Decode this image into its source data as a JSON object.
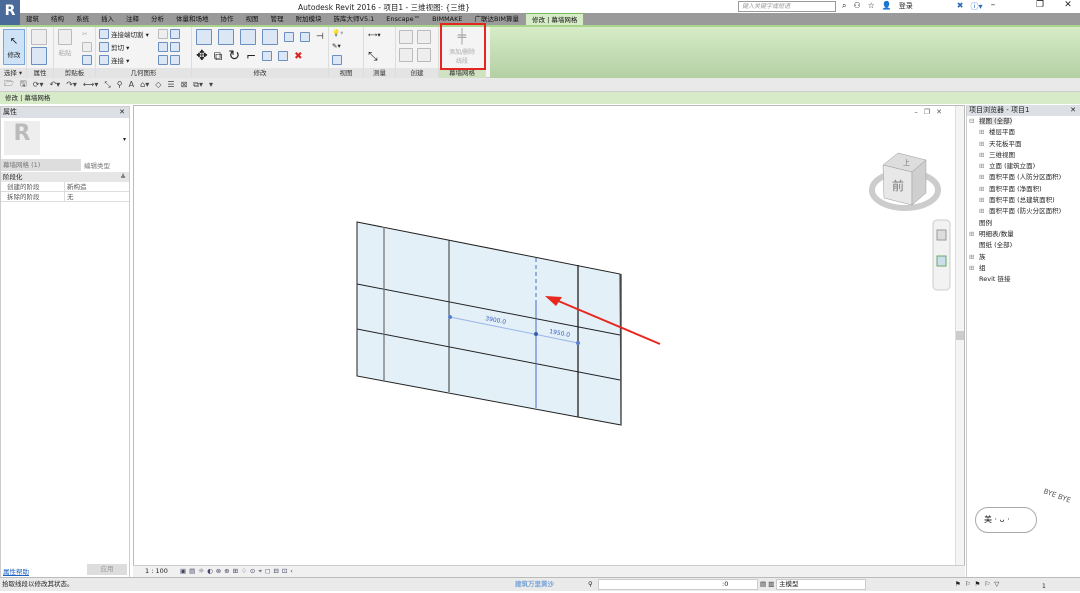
{
  "app": {
    "title": "Autodesk Revit 2016 -    项目1 - 三维视图: {三维}",
    "search_placeholder": "键入关键字或短语",
    "login": "登录",
    "logo": "R"
  },
  "tabs": [
    "建筑",
    "结构",
    "系统",
    "插入",
    "注释",
    "分析",
    "体量和场地",
    "协作",
    "视图",
    "管理",
    "附加模块",
    "族库大师V5.1",
    "Enscape™",
    "BIMMAKE",
    "广联达BIM算量",
    "修改 | 幕墙网格"
  ],
  "ribbon": {
    "select": {
      "modify": "修改",
      "label": "选择 ▾"
    },
    "properties": {
      "label": "属性"
    },
    "clipboard": {
      "paste": "粘贴",
      "label": "剪贴板"
    },
    "geometry": {
      "items": [
        "连接端切割 ▾",
        "剪切 ▾",
        "连接 ▾"
      ],
      "label": "几何图形"
    },
    "modify": {
      "label": "修改"
    },
    "view": {
      "label": "视图"
    },
    "measure": {
      "label": "测量"
    },
    "create": {
      "label": "创建"
    },
    "curtain_grid": {
      "button": "添加/删除线段",
      "label": "幕墙网格"
    }
  },
  "context_bar": "修改 | 幕墙网格",
  "properties": {
    "title": "属性",
    "type_selector": "幕墙网格 (1)",
    "edit_type": "编辑类型",
    "group": "阶段化",
    "rows": [
      {
        "name": "创建的阶段",
        "value": "新构造"
      },
      {
        "name": "拆除的阶段",
        "value": "无"
      }
    ],
    "help": "属性帮助",
    "apply": "应用"
  },
  "viewcube": {
    "face": "前",
    "top": "上"
  },
  "dimensions": [
    "3900.0",
    "1950.0"
  ],
  "browser": {
    "title": "项目浏览器 - 项目1",
    "items": [
      {
        "label": "视图 (全部)",
        "level": 0,
        "toggle": "⊟"
      },
      {
        "label": "楼层平面",
        "level": 1,
        "toggle": "⊞"
      },
      {
        "label": "天花板平面",
        "level": 1,
        "toggle": "⊞"
      },
      {
        "label": "三维视图",
        "level": 1,
        "toggle": "⊞"
      },
      {
        "label": "立面 (建筑立面)",
        "level": 1,
        "toggle": "⊞"
      },
      {
        "label": "面积平面 (人防分区面积)",
        "level": 1,
        "toggle": "⊞"
      },
      {
        "label": "面积平面 (净面积)",
        "level": 1,
        "toggle": "⊞"
      },
      {
        "label": "面积平面 (总建筑面积)",
        "level": 1,
        "toggle": "⊞"
      },
      {
        "label": "面积平面 (防火分区面积)",
        "level": 1,
        "toggle": "⊞"
      },
      {
        "label": "图例",
        "level": 0,
        "toggle": ""
      },
      {
        "label": "明细表/数量",
        "level": 0,
        "toggle": "⊞"
      },
      {
        "label": "图纸 (全部)",
        "level": 0,
        "toggle": ""
      },
      {
        "label": "族",
        "level": 0,
        "toggle": "⊞"
      },
      {
        "label": "组",
        "level": 0,
        "toggle": "⊞"
      },
      {
        "label": "Revit 链接",
        "level": 0,
        "toggle": ""
      }
    ]
  },
  "view_control": {
    "scale": "1 : 100"
  },
  "status": {
    "message": "拾取线段以修改其状态。",
    "watermark": "建筑万里黄沙",
    "filter_count": ":0",
    "model": "主模型",
    "selection_count": "1"
  },
  "sticker": {
    "text": "美 · ᴗ ·",
    "bye": "BYE BYE"
  }
}
